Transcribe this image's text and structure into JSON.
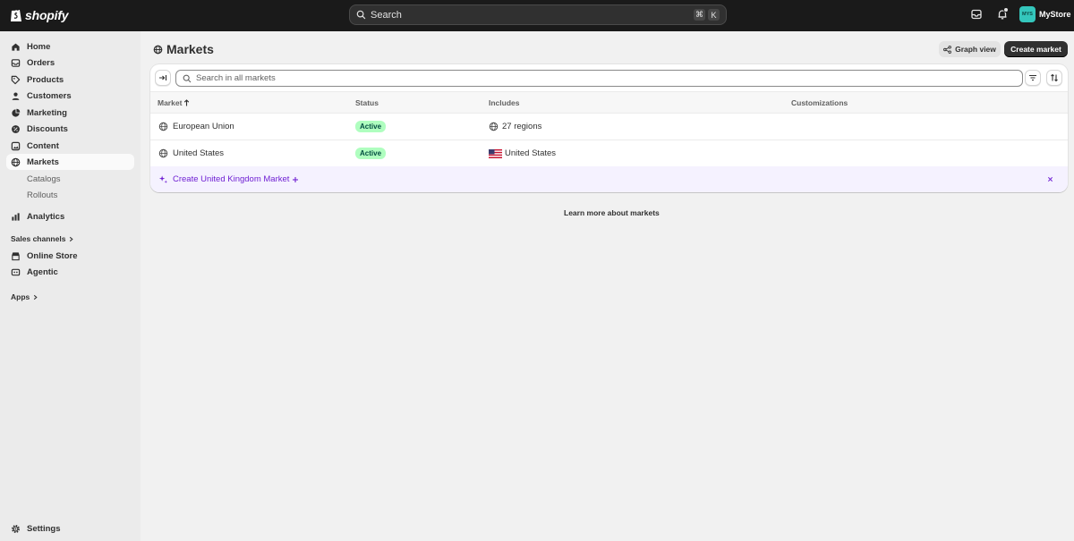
{
  "topbar": {
    "logo_text": "shopify",
    "search_placeholder": "Search",
    "shortcut_cmd": "⌘",
    "shortcut_key": "K",
    "store_initials": "MYS",
    "store_name": "MyStore"
  },
  "sidebar": {
    "items": [
      {
        "label": "Home",
        "icon": "home-icon"
      },
      {
        "label": "Orders",
        "icon": "orders-icon"
      },
      {
        "label": "Products",
        "icon": "products-icon"
      },
      {
        "label": "Customers",
        "icon": "customers-icon"
      },
      {
        "label": "Marketing",
        "icon": "marketing-icon"
      },
      {
        "label": "Discounts",
        "icon": "discounts-icon"
      },
      {
        "label": "Content",
        "icon": "content-icon"
      },
      {
        "label": "Markets",
        "icon": "globe-icon"
      }
    ],
    "sub_items": [
      "Catalogs",
      "Rollouts"
    ],
    "analytics": "Analytics",
    "sales_channels_heading": "Sales channels",
    "channels": [
      "Online Store",
      "Agentic"
    ],
    "apps_heading": "Apps",
    "settings": "Settings"
  },
  "page": {
    "title": "Markets",
    "graph_view_label": "Graph view",
    "create_market_label": "Create market"
  },
  "table": {
    "search_placeholder": "Search in all markets",
    "columns": [
      "Market",
      "Status",
      "Includes",
      "Customizations"
    ],
    "rows": [
      {
        "market": "European Union",
        "status": "Active",
        "includes": "27 regions",
        "include_icon": "globe-icon"
      },
      {
        "market": "United States",
        "status": "Active",
        "includes": "United States",
        "include_icon": "us-flag-icon"
      }
    ],
    "suggestion": "Create United Kingdom Market"
  },
  "footer_link": "Learn more about markets",
  "colors": {
    "active_badge_bg": "#affebf",
    "active_badge_text": "#014b40",
    "suggestion_purple": "#6f1fd3",
    "topbar_bg": "#1a1a1a",
    "avatar_bg": "#34c6bc"
  }
}
